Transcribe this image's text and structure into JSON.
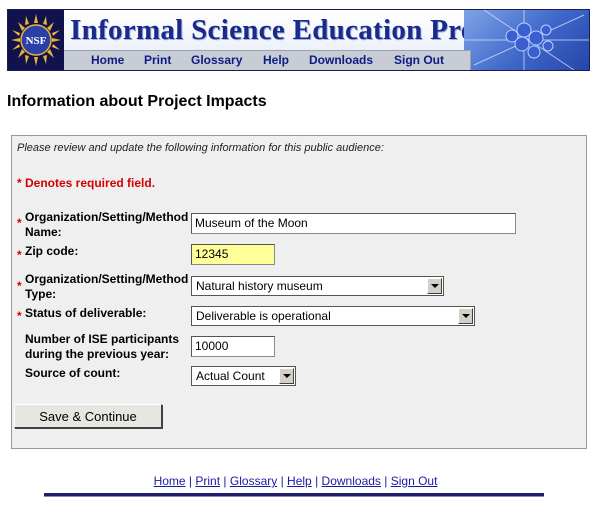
{
  "banner": {
    "logo_text": "NSF",
    "title": "Informal Science Education Program",
    "nav": [
      "Home",
      "Print",
      "Glossary",
      "Help",
      "Downloads",
      "Sign Out"
    ]
  },
  "page": {
    "heading": "Information about Project Impacts"
  },
  "form": {
    "intro": "Please review and update the following information for this public audience:",
    "required_note": "* Denotes required field.",
    "required_marker": "*",
    "fields": {
      "org_name": {
        "label_line1": "Organization/Setting/Method",
        "label_line2": "Name:",
        "value": "Museum of the Moon"
      },
      "zip": {
        "label": "Zip code:",
        "value": "12345"
      },
      "org_type": {
        "label_line1": "Organization/Setting/Method",
        "label_line2": "Type:",
        "value": "Natural history museum"
      },
      "status": {
        "label": "Status of deliverable:",
        "value": "Deliverable is operational"
      },
      "participants": {
        "label_line1": "Number of ISE participants",
        "label_line2": "during the previous year:",
        "value": "10000"
      },
      "source": {
        "label": "Source of count:",
        "value": "Actual Count"
      }
    },
    "submit_label": "Save & Continue"
  },
  "footer": {
    "links": [
      "Home",
      "Print",
      "Glossary",
      "Help",
      "Downloads",
      "Sign Out"
    ],
    "separator": "|"
  },
  "colors": {
    "required": "#d40000",
    "link": "#1a1aa6",
    "banner_title": "#1a2a8a",
    "zip_highlight": "#ffff99"
  }
}
